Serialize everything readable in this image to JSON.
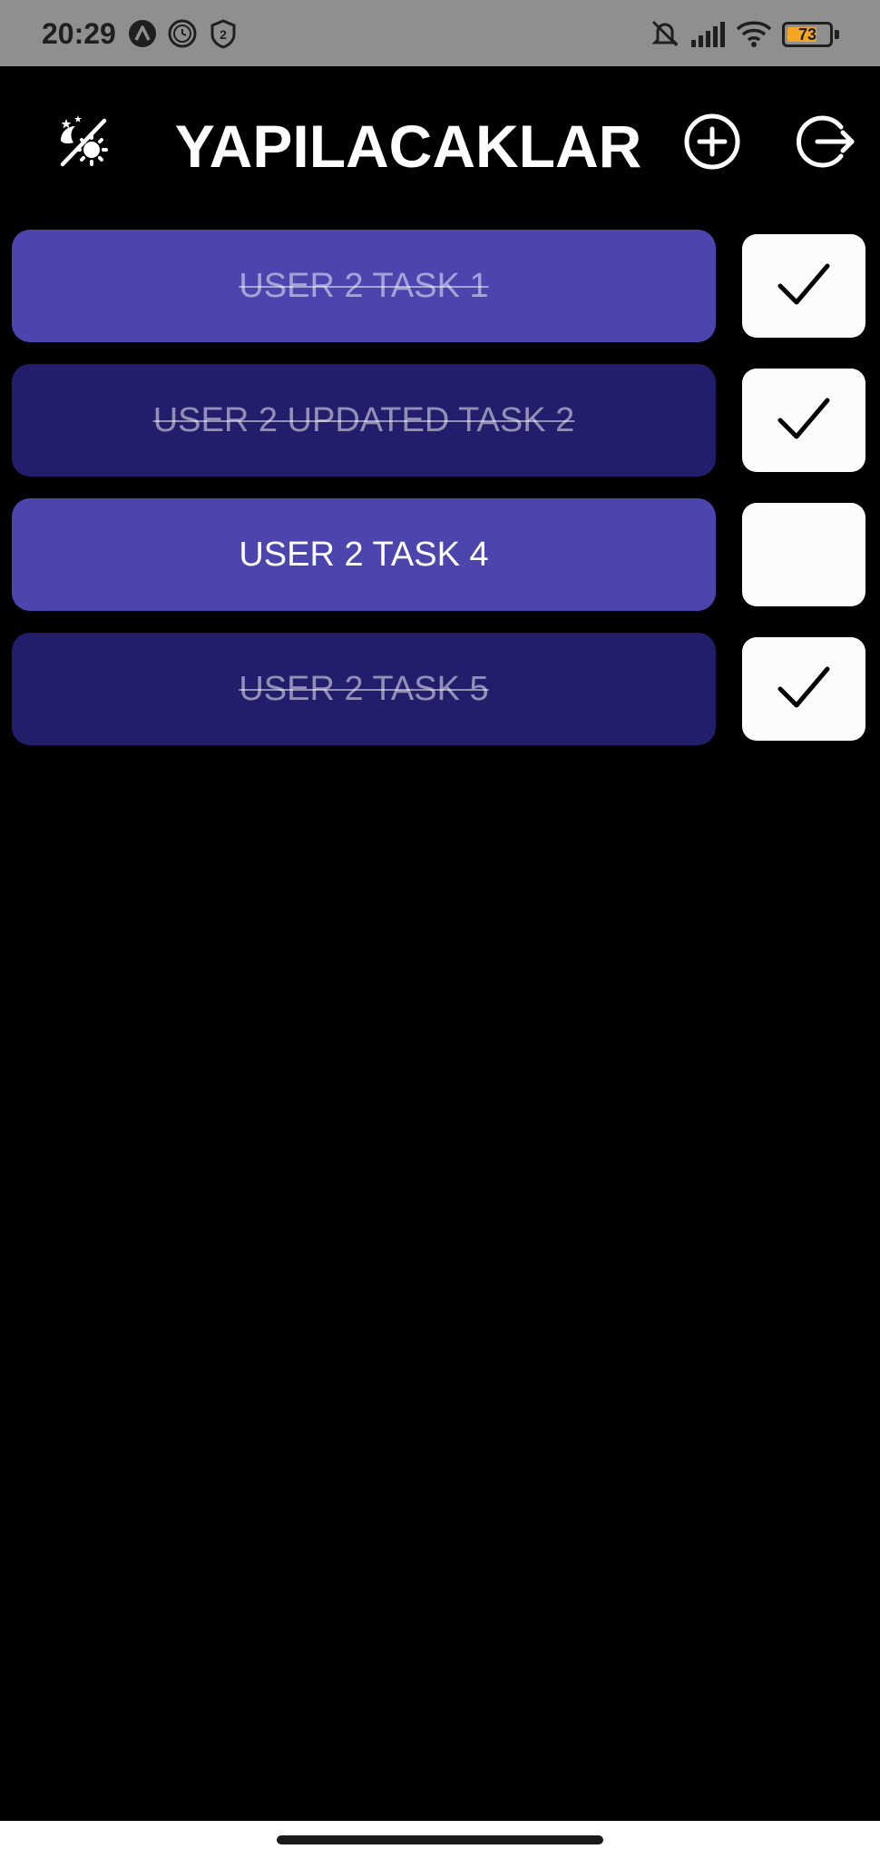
{
  "status_bar": {
    "time": "20:29",
    "battery_level": "73",
    "battery_fraction": 0.73,
    "icons": [
      "launcher-a-icon",
      "clock-icon",
      "shield-2-icon",
      "mute-icon",
      "signal-icon",
      "wifi-icon",
      "battery-icon"
    ]
  },
  "header": {
    "title": "YAPILACAKLAR",
    "theme_toggle_icon": "theme-toggle-icon",
    "add_icon": "add-circle-icon",
    "logout_icon": "logout-icon"
  },
  "tasks": [
    {
      "label": "USER 2 TASK 1",
      "done": true,
      "color": "#4b45ad"
    },
    {
      "label": "USER 2 UPDATED TASK 2",
      "done": true,
      "color": "#221e6b"
    },
    {
      "label": "USER 2 TASK 4",
      "done": false,
      "color": "#4b45ad"
    },
    {
      "label": "USER 2 TASK 5",
      "done": true,
      "color": "#221e6b"
    }
  ],
  "colors": {
    "background": "#000000",
    "status_bar": "#8f8f8f",
    "task_light": "#4b45ad",
    "task_dark": "#221e6b",
    "checkbox": "#fcfcfc",
    "battery": "#f5a623"
  }
}
